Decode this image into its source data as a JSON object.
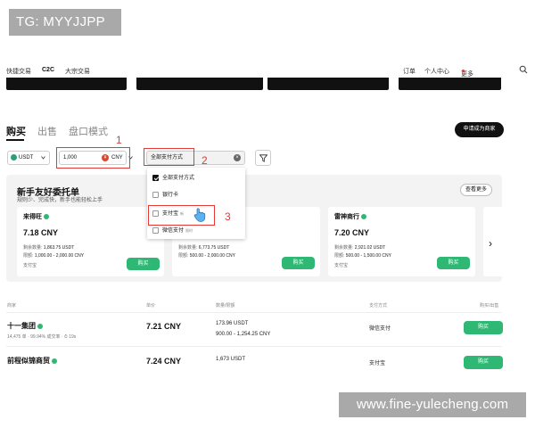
{
  "tags": {
    "tg": "TG: MYYJJPP",
    "site": "www.fine-yulecheng.com"
  },
  "nav": {
    "items": [
      "快捷交易",
      "C2C",
      "大宗交易"
    ],
    "right": [
      "订单",
      "个人中心",
      "更多"
    ],
    "search_icon": "search-icon"
  },
  "tabs": {
    "buy": "购买",
    "sell": "出售",
    "orderbook": "盘口模式",
    "merchant": "申请成为商家"
  },
  "filters": {
    "coin": "USDT",
    "amount": "1,000",
    "currency": "CNY",
    "currency_symbol": "¥",
    "payment": "全部支付方式",
    "clear": "×"
  },
  "annotations": [
    "1",
    "2",
    "3"
  ],
  "dropdown": {
    "items": [
      {
        "label": "全部支付方式",
        "checked": true
      },
      {
        "label": "银行卡",
        "checked": false
      },
      {
        "label": "支付宝",
        "checked": false,
        "badge": "新"
      },
      {
        "label": "微信支付",
        "checked": false,
        "badge": "限时"
      }
    ]
  },
  "promo": {
    "title": "新手友好委托单",
    "subtitle": "规则少、完成快，新手也能轻松上手",
    "more": "查看更多",
    "cards": [
      {
        "name": "来得旺",
        "price": "7.18 CNY",
        "qty_label": "剩余数量:",
        "qty": "1,863.75 USDT",
        "limit_label": "限额:",
        "limit": "1,000.00 - 2,000.00 CNY",
        "payment": "支付宝",
        "buy": "购买"
      },
      {
        "name": "",
        "price": "",
        "qty_label": "剩余数量:",
        "qty": "6,773.75 USDT",
        "limit_label": "限额:",
        "limit": "500.00 - 2,000.00 CNY",
        "payment": "",
        "buy": "购买"
      },
      {
        "name": "雷神商行",
        "price": "7.20 CNY",
        "qty_label": "剩余数量:",
        "qty": "2,921.02 USDT",
        "limit_label": "限额:",
        "limit": "500.00 - 1,500.00 CNY",
        "payment": "支付宝",
        "buy": "购买"
      }
    ],
    "next": "›"
  },
  "table": {
    "headers": [
      "商家",
      "单价",
      "数量/限额",
      "支付方式",
      "购买/出售"
    ],
    "rows": [
      {
        "name": "十一集团",
        "stats": "14,475 单  ·  99.94% 成交率  ·  ⏱ 19s",
        "price": "7.21 CNY",
        "qty": "173.96 USDT",
        "limit": "900.00 - 1,254.25 CNY",
        "payment": "微信支付",
        "buy": "购买"
      },
      {
        "name": "前程似锦商贸",
        "stats": "",
        "price": "7.24 CNY",
        "qty": "1,673 USDT",
        "limit": "",
        "payment": "支付宝",
        "buy": "购买"
      }
    ]
  }
}
